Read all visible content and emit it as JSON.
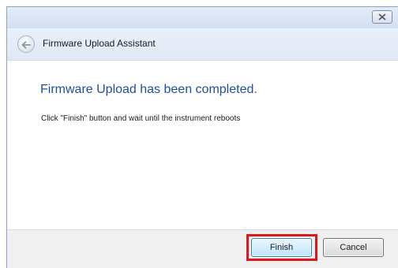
{
  "window": {
    "header_title": "Firmware Upload Assistant"
  },
  "content": {
    "heading": "Firmware Upload has been completed.",
    "instruction": "Click \"Finish\" button and wait until the instrument reboots"
  },
  "footer": {
    "finish_label": "Finish",
    "cancel_label": "Cancel"
  },
  "icons": {
    "close": "close-icon",
    "back": "back-arrow-icon"
  },
  "colors": {
    "heading": "#1e4f9c",
    "highlight": "#e0161d",
    "chrome": "#dce6f4"
  }
}
